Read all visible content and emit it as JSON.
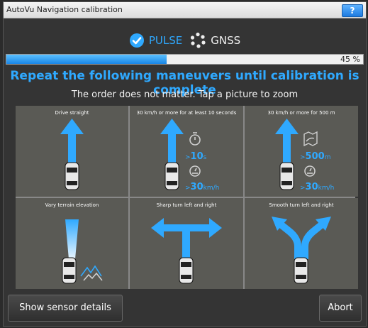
{
  "window": {
    "title": "AutoVu Navigation calibration",
    "help_label": "?"
  },
  "status": {
    "pulse_label": "PULSE",
    "gnss_label": "GNSS",
    "progress_percent": 45,
    "progress_text": "45 %"
  },
  "headline": "Repeat the following maneuvers until calibration is complete",
  "subline": "The order does not matter. Tap a picture to zoom",
  "tiles": [
    {
      "title": "Drive straight"
    },
    {
      "title": "30 km/h or more for at least 10 seconds",
      "metric1_prefix": ">",
      "metric1_value": "10",
      "metric1_unit": "s",
      "metric2_prefix": ">",
      "metric2_value": "30",
      "metric2_unit": "km/h"
    },
    {
      "title": "30 km/h or more for 500 m",
      "metric1_prefix": ">",
      "metric1_value": "500",
      "metric1_unit": "m",
      "metric2_prefix": ">",
      "metric2_value": "30",
      "metric2_unit": "km/h"
    },
    {
      "title": "Vary terrain elevation"
    },
    {
      "title": "Sharp turn left and right"
    },
    {
      "title": "Smooth turn left and right"
    }
  ],
  "buttons": {
    "sensor_details": "Show sensor details",
    "abort": "Abort"
  },
  "colors": {
    "accent": "#2fa9ff",
    "tile_bg": "#5a5a55",
    "window_bg": "#343434"
  }
}
